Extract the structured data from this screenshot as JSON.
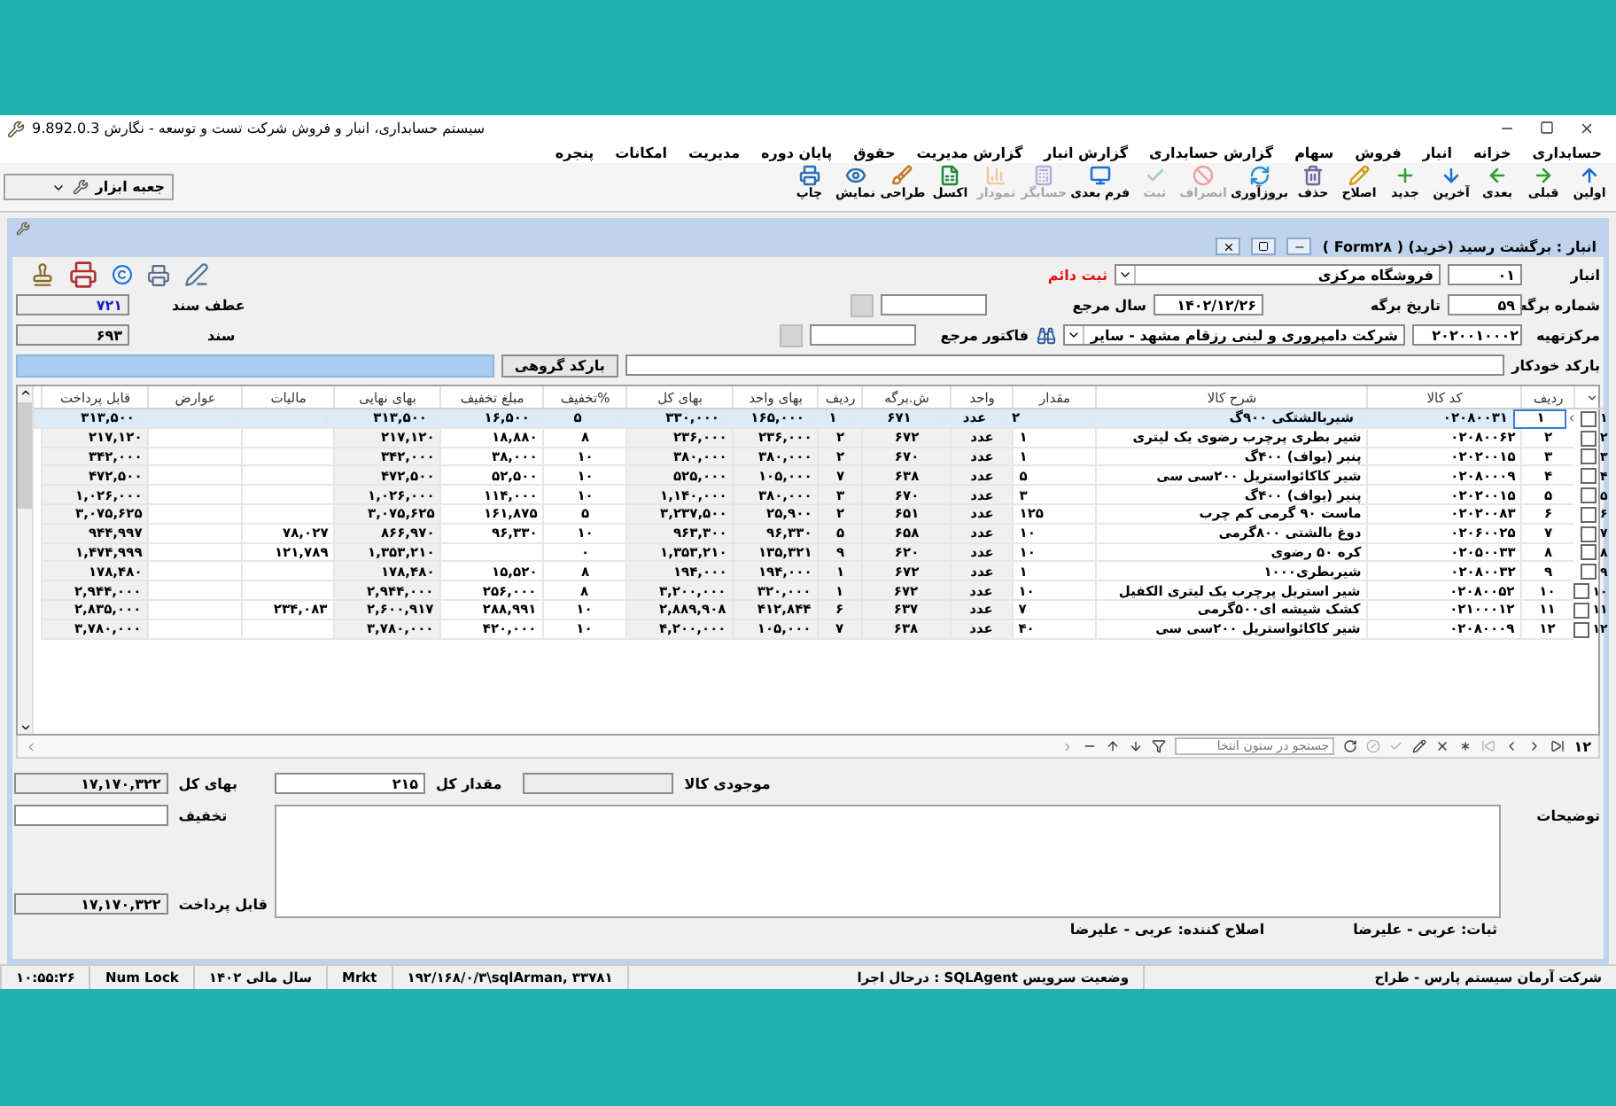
{
  "app": {
    "title": "سیستم حسابداری، انبار و فروش شرکت تست و توسعه - نگارش 9.892.0.3"
  },
  "menu": [
    "حسابداری",
    "خزانه",
    "انبار",
    "فروش",
    "سهام",
    "گزارش حسابداری",
    "گزارش انبار",
    "گزارش مدیریت",
    "حقوق",
    "پایان دوره",
    "مدیریت",
    "امکانات",
    "پنجره"
  ],
  "toolbar": [
    {
      "label": "اولین",
      "disabled": false
    },
    {
      "label": "قبلی",
      "disabled": false
    },
    {
      "label": "بعدی",
      "disabled": false
    },
    {
      "label": "آخرین",
      "disabled": false
    },
    {
      "label": "جدید",
      "disabled": false
    },
    {
      "label": "اصلاح",
      "disabled": false
    },
    {
      "label": "حذف",
      "disabled": false
    },
    {
      "label": "بروزآوری",
      "disabled": false
    },
    {
      "label": "انصراف",
      "disabled": true
    },
    {
      "label": "ثبت",
      "disabled": true
    },
    {
      "label": "فرم بعدی",
      "disabled": false
    },
    {
      "label": "حسابگر",
      "disabled": true
    },
    {
      "label": "نمودار",
      "disabled": true
    },
    {
      "label": "اکسل",
      "disabled": false
    },
    {
      "label": "طراحی",
      "disabled": false
    },
    {
      "label": "نمایش",
      "disabled": false
    },
    {
      "label": "چاپ",
      "disabled": false
    }
  ],
  "toolbox": {
    "label": "جعبه ابزار"
  },
  "form_window": {
    "title": "انبار : برگشت رسید (خرید) ( Form۲۸ )"
  },
  "header": {
    "warehouse_label": "انبار",
    "warehouse_code": "۰۱",
    "warehouse_name": "فروشگاه مرکزی",
    "status": "ثبت دائم",
    "sheet_no_label": "شماره برگه",
    "sheet_no": "۵۹",
    "date_label": "تاریخ برگه",
    "date": "۱۴۰۲/۱۲/۲۶",
    "ref_year_label": "سال مرجع",
    "supplier_label": "مرکزتهیه",
    "supplier_code": "۲۰۲۰۰۱۰۰۰۲",
    "supplier_name": "شرکت دامپروری و لبنی رزقام مشهد - سایر",
    "ref_invoice_label": "فاکتور مرجع",
    "doc_ref_label": "عطف سند",
    "doc_ref": "۷۲۱",
    "doc_label": "سند",
    "doc": "۶۹۳",
    "barcode_label": "بارکد خودکار",
    "group_barcode_button": "بارکد گروهی"
  },
  "grid": {
    "columns": [
      {
        "label": "ردیف",
        "readonly": false
      },
      {
        "label": "کد کالا",
        "readonly": false
      },
      {
        "label": "شرح کالا",
        "readonly": false
      },
      {
        "label": "مقدار",
        "readonly": false
      },
      {
        "label": "واحد",
        "readonly": true
      },
      {
        "label": "ش.برگه",
        "readonly": true
      },
      {
        "label": "ردیف",
        "readonly": true
      },
      {
        "label": "بهای واحد",
        "readonly": true
      },
      {
        "label": "بهای کل",
        "readonly": true
      },
      {
        "label": "%تخفیف",
        "readonly": false
      },
      {
        "label": "مبلغ تخفیف",
        "readonly": false
      },
      {
        "label": "بهای نهایی",
        "readonly": true
      },
      {
        "label": "مالیات",
        "readonly": false
      },
      {
        "label": "عوارض",
        "readonly": false
      },
      {
        "label": "قابل پرداخت",
        "readonly": true
      }
    ],
    "rows": [
      {
        "number": "۱",
        "checked": false,
        "selected": true,
        "cells": [
          "۱",
          "۰۲۰۸۰۰۳۱",
          "شیربالشتکی ۹۰۰گ",
          "۲",
          "عدد",
          "۶۷۱",
          "۱",
          "۱۶۵,۰۰۰",
          "۳۳۰,۰۰۰",
          "۵",
          "۱۶,۵۰۰",
          "۳۱۳,۵۰۰",
          null,
          null,
          "۳۱۳,۵۰۰"
        ]
      },
      {
        "number": "۲",
        "checked": false,
        "selected": false,
        "cells": [
          "۲",
          "۰۲۰۸۰۰۶۲",
          "شیر بطری پرچرب رضوی یک لیتری",
          "۱",
          "عدد",
          "۶۷۲",
          "۲",
          "۲۳۶,۰۰۰",
          "۲۳۶,۰۰۰",
          "۸",
          "۱۸,۸۸۰",
          "۲۱۷,۱۲۰",
          null,
          null,
          "۲۱۷,۱۲۰"
        ]
      },
      {
        "number": "۳",
        "checked": false,
        "selected": false,
        "cells": [
          "۳",
          "۰۲۰۲۰۰۱۵",
          "پنیر (یواف) ۴۰۰گ",
          "۱",
          "عدد",
          "۶۷۰",
          "۲",
          "۳۸۰,۰۰۰",
          "۳۸۰,۰۰۰",
          "۱۰",
          "۳۸,۰۰۰",
          "۳۴۲,۰۰۰",
          null,
          null,
          "۳۴۲,۰۰۰"
        ]
      },
      {
        "number": "۴",
        "checked": false,
        "selected": false,
        "cells": [
          "۴",
          "۰۲۰۸۰۰۰۹",
          "شیر کاکائواستریل ۲۰۰سی سی",
          "۵",
          "عدد",
          "۶۳۸",
          "۷",
          "۱۰۵,۰۰۰",
          "۵۲۵,۰۰۰",
          "۱۰",
          "۵۲,۵۰۰",
          "۴۷۲,۵۰۰",
          null,
          null,
          "۴۷۲,۵۰۰"
        ]
      },
      {
        "number": "۵",
        "checked": false,
        "selected": false,
        "cells": [
          "۵",
          "۰۲۰۲۰۰۱۵",
          "پنیر (یواف) ۴۰۰گ",
          "۳",
          "عدد",
          "۶۷۰",
          "۳",
          "۳۸۰,۰۰۰",
          "۱,۱۴۰,۰۰۰",
          "۱۰",
          "۱۱۴,۰۰۰",
          "۱,۰۲۶,۰۰۰",
          null,
          null,
          "۱,۰۲۶,۰۰۰"
        ]
      },
      {
        "number": "۶",
        "checked": false,
        "selected": false,
        "cells": [
          "۶",
          "۰۲۰۲۰۰۸۳",
          "ماست ۹۰ گرمی کم چرب",
          "۱۲۵",
          "عدد",
          "۶۵۱",
          "۲",
          "۲۵,۹۰۰",
          "۳,۲۳۷,۵۰۰",
          "۵",
          "۱۶۱,۸۷۵",
          "۳,۰۷۵,۶۲۵",
          null,
          null,
          "۳,۰۷۵,۶۲۵"
        ]
      },
      {
        "number": "۷",
        "checked": false,
        "selected": false,
        "cells": [
          "۷",
          "۰۲۰۶۰۰۲۵",
          "دوغ بالشتی ۸۰۰گرمی",
          "۱۰",
          "عدد",
          "۶۵۸",
          "۵",
          "۹۶,۳۳۰",
          "۹۶۳,۳۰۰",
          "۱۰",
          "۹۶,۳۳۰",
          "۸۶۶,۹۷۰",
          "۷۸,۰۲۷",
          null,
          "۹۴۴,۹۹۷"
        ]
      },
      {
        "number": "۸",
        "checked": false,
        "selected": false,
        "cells": [
          "۸",
          "۰۲۰۵۰۰۳۳",
          "کره ۵۰ رضوی",
          "۱۰",
          "عدد",
          "۶۲۰",
          "۹",
          "۱۳۵,۳۲۱",
          "۱,۳۵۳,۲۱۰",
          "۰",
          null,
          "۱,۳۵۳,۲۱۰",
          "۱۲۱,۷۸۹",
          null,
          "۱,۴۷۴,۹۹۹"
        ]
      },
      {
        "number": "۹",
        "checked": false,
        "selected": false,
        "cells": [
          "۹",
          "۰۲۰۸۰۰۳۲",
          "شیربطری۱۰۰۰",
          "۱",
          "عدد",
          "۶۷۲",
          "۱",
          "۱۹۴,۰۰۰",
          "۱۹۴,۰۰۰",
          "۸",
          "۱۵,۵۲۰",
          "۱۷۸,۴۸۰",
          null,
          null,
          "۱۷۸,۴۸۰"
        ]
      },
      {
        "number": "۱۰",
        "checked": false,
        "selected": false,
        "cells": [
          "۱۰",
          "۰۲۰۸۰۰۵۲",
          "شیر استریل پرچرب یک لیتری الکفیل",
          "۱۰",
          "عدد",
          "۶۷۲",
          "۱",
          "۳۲۰,۰۰۰",
          "۳,۲۰۰,۰۰۰",
          "۸",
          "۲۵۶,۰۰۰",
          "۲,۹۴۴,۰۰۰",
          null,
          null,
          "۲,۹۴۴,۰۰۰"
        ]
      },
      {
        "number": "۱۱",
        "checked": false,
        "selected": false,
        "cells": [
          "۱۱",
          "۰۲۱۰۰۰۱۲",
          "کشک شیشه ای۵۰۰گرمی",
          "۷",
          "عدد",
          "۶۳۷",
          "۶",
          "۴۱۲,۸۴۴",
          "۲,۸۸۹,۹۰۸",
          "۱۰",
          "۲۸۸,۹۹۱",
          "۲,۶۰۰,۹۱۷",
          "۲۳۴,۰۸۳",
          null,
          "۲,۸۳۵,۰۰۰"
        ]
      },
      {
        "number": "۱۲",
        "checked": false,
        "selected": false,
        "cells": [
          "۱۲",
          "۰۲۰۸۰۰۰۹",
          "شیر کاکائواستریل ۲۰۰سی سی",
          "۴۰",
          "عدد",
          "۶۳۸",
          "۷",
          "۱۰۵,۰۰۰",
          "۴,۲۰۰,۰۰۰",
          "۱۰",
          "۴۲۰,۰۰۰",
          "۳,۷۸۰,۰۰۰",
          null,
          null,
          "۳,۷۸۰,۰۰۰"
        ]
      }
    ]
  },
  "navigator": {
    "count": "۱۲",
    "search_placeholder": "جستجو در ستون انتخا"
  },
  "totals": {
    "stock_label": "موجودی کالا",
    "total_qty_label": "مقدار کل",
    "total_qty": "۲۱۵",
    "total_price_label": "بهای کل",
    "total_price": "۱۷,۱۷۰,۳۲۲",
    "notes_label": "توضیحات",
    "discount_label": "تخفیف",
    "payable_label": "قابل پرداخت",
    "payable": "۱۷,۱۷۰,۳۲۲"
  },
  "audit": {
    "created_by": "ثبات: عربی - علیرضا",
    "modified_by": "اصلاح کننده: عربی - علیرضا"
  },
  "status_bar": [
    "شرکت آرمان سیستم پارس - طراح",
    "وضعیت سرویس SQLAgent : درحال اجرا",
    "۱۹۲/۱۶۸/۰/۳\\sqlArman, ۳۳۷۸۱",
    "Mrkt",
    "سال مالی ۱۴۰۲",
    "Num Lock",
    "۱۰:۵۵:۲۶"
  ]
}
